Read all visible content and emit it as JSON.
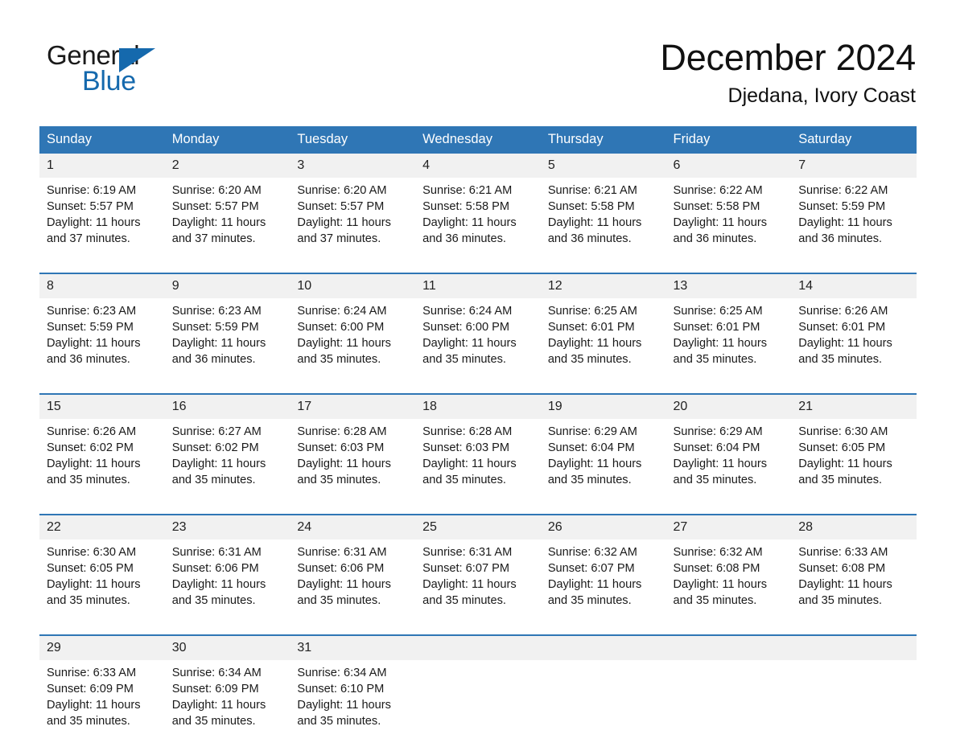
{
  "brand": {
    "name_part1": "General",
    "name_part2": "Blue",
    "accent_color": "#1569ad",
    "triangle_icon": "triangle-icon"
  },
  "header": {
    "title": "December 2024",
    "location": "Djedana, Ivory Coast"
  },
  "colors": {
    "header_bar": "#2f76b5",
    "daynum_strip": "#f1f1f1",
    "separator": "#2f76b5"
  },
  "weekdays": [
    "Sunday",
    "Monday",
    "Tuesday",
    "Wednesday",
    "Thursday",
    "Friday",
    "Saturday"
  ],
  "weeks": [
    {
      "days": [
        {
          "date": "1",
          "sunrise": "Sunrise: 6:19 AM",
          "sunset": "Sunset: 5:57 PM",
          "daylight": "Daylight: 11 hours and 37 minutes."
        },
        {
          "date": "2",
          "sunrise": "Sunrise: 6:20 AM",
          "sunset": "Sunset: 5:57 PM",
          "daylight": "Daylight: 11 hours and 37 minutes."
        },
        {
          "date": "3",
          "sunrise": "Sunrise: 6:20 AM",
          "sunset": "Sunset: 5:57 PM",
          "daylight": "Daylight: 11 hours and 37 minutes."
        },
        {
          "date": "4",
          "sunrise": "Sunrise: 6:21 AM",
          "sunset": "Sunset: 5:58 PM",
          "daylight": "Daylight: 11 hours and 36 minutes."
        },
        {
          "date": "5",
          "sunrise": "Sunrise: 6:21 AM",
          "sunset": "Sunset: 5:58 PM",
          "daylight": "Daylight: 11 hours and 36 minutes."
        },
        {
          "date": "6",
          "sunrise": "Sunrise: 6:22 AM",
          "sunset": "Sunset: 5:58 PM",
          "daylight": "Daylight: 11 hours and 36 minutes."
        },
        {
          "date": "7",
          "sunrise": "Sunrise: 6:22 AM",
          "sunset": "Sunset: 5:59 PM",
          "daylight": "Daylight: 11 hours and 36 minutes."
        }
      ]
    },
    {
      "days": [
        {
          "date": "8",
          "sunrise": "Sunrise: 6:23 AM",
          "sunset": "Sunset: 5:59 PM",
          "daylight": "Daylight: 11 hours and 36 minutes."
        },
        {
          "date": "9",
          "sunrise": "Sunrise: 6:23 AM",
          "sunset": "Sunset: 5:59 PM",
          "daylight": "Daylight: 11 hours and 36 minutes."
        },
        {
          "date": "10",
          "sunrise": "Sunrise: 6:24 AM",
          "sunset": "Sunset: 6:00 PM",
          "daylight": "Daylight: 11 hours and 35 minutes."
        },
        {
          "date": "11",
          "sunrise": "Sunrise: 6:24 AM",
          "sunset": "Sunset: 6:00 PM",
          "daylight": "Daylight: 11 hours and 35 minutes."
        },
        {
          "date": "12",
          "sunrise": "Sunrise: 6:25 AM",
          "sunset": "Sunset: 6:01 PM",
          "daylight": "Daylight: 11 hours and 35 minutes."
        },
        {
          "date": "13",
          "sunrise": "Sunrise: 6:25 AM",
          "sunset": "Sunset: 6:01 PM",
          "daylight": "Daylight: 11 hours and 35 minutes."
        },
        {
          "date": "14",
          "sunrise": "Sunrise: 6:26 AM",
          "sunset": "Sunset: 6:01 PM",
          "daylight": "Daylight: 11 hours and 35 minutes."
        }
      ]
    },
    {
      "days": [
        {
          "date": "15",
          "sunrise": "Sunrise: 6:26 AM",
          "sunset": "Sunset: 6:02 PM",
          "daylight": "Daylight: 11 hours and 35 minutes."
        },
        {
          "date": "16",
          "sunrise": "Sunrise: 6:27 AM",
          "sunset": "Sunset: 6:02 PM",
          "daylight": "Daylight: 11 hours and 35 minutes."
        },
        {
          "date": "17",
          "sunrise": "Sunrise: 6:28 AM",
          "sunset": "Sunset: 6:03 PM",
          "daylight": "Daylight: 11 hours and 35 minutes."
        },
        {
          "date": "18",
          "sunrise": "Sunrise: 6:28 AM",
          "sunset": "Sunset: 6:03 PM",
          "daylight": "Daylight: 11 hours and 35 minutes."
        },
        {
          "date": "19",
          "sunrise": "Sunrise: 6:29 AM",
          "sunset": "Sunset: 6:04 PM",
          "daylight": "Daylight: 11 hours and 35 minutes."
        },
        {
          "date": "20",
          "sunrise": "Sunrise: 6:29 AM",
          "sunset": "Sunset: 6:04 PM",
          "daylight": "Daylight: 11 hours and 35 minutes."
        },
        {
          "date": "21",
          "sunrise": "Sunrise: 6:30 AM",
          "sunset": "Sunset: 6:05 PM",
          "daylight": "Daylight: 11 hours and 35 minutes."
        }
      ]
    },
    {
      "days": [
        {
          "date": "22",
          "sunrise": "Sunrise: 6:30 AM",
          "sunset": "Sunset: 6:05 PM",
          "daylight": "Daylight: 11 hours and 35 minutes."
        },
        {
          "date": "23",
          "sunrise": "Sunrise: 6:31 AM",
          "sunset": "Sunset: 6:06 PM",
          "daylight": "Daylight: 11 hours and 35 minutes."
        },
        {
          "date": "24",
          "sunrise": "Sunrise: 6:31 AM",
          "sunset": "Sunset: 6:06 PM",
          "daylight": "Daylight: 11 hours and 35 minutes."
        },
        {
          "date": "25",
          "sunrise": "Sunrise: 6:31 AM",
          "sunset": "Sunset: 6:07 PM",
          "daylight": "Daylight: 11 hours and 35 minutes."
        },
        {
          "date": "26",
          "sunrise": "Sunrise: 6:32 AM",
          "sunset": "Sunset: 6:07 PM",
          "daylight": "Daylight: 11 hours and 35 minutes."
        },
        {
          "date": "27",
          "sunrise": "Sunrise: 6:32 AM",
          "sunset": "Sunset: 6:08 PM",
          "daylight": "Daylight: 11 hours and 35 minutes."
        },
        {
          "date": "28",
          "sunrise": "Sunrise: 6:33 AM",
          "sunset": "Sunset: 6:08 PM",
          "daylight": "Daylight: 11 hours and 35 minutes."
        }
      ]
    },
    {
      "days": [
        {
          "date": "29",
          "sunrise": "Sunrise: 6:33 AM",
          "sunset": "Sunset: 6:09 PM",
          "daylight": "Daylight: 11 hours and 35 minutes."
        },
        {
          "date": "30",
          "sunrise": "Sunrise: 6:34 AM",
          "sunset": "Sunset: 6:09 PM",
          "daylight": "Daylight: 11 hours and 35 minutes."
        },
        {
          "date": "31",
          "sunrise": "Sunrise: 6:34 AM",
          "sunset": "Sunset: 6:10 PM",
          "daylight": "Daylight: 11 hours and 35 minutes."
        },
        {
          "date": "",
          "sunrise": "",
          "sunset": "",
          "daylight": ""
        },
        {
          "date": "",
          "sunrise": "",
          "sunset": "",
          "daylight": ""
        },
        {
          "date": "",
          "sunrise": "",
          "sunset": "",
          "daylight": ""
        },
        {
          "date": "",
          "sunrise": "",
          "sunset": "",
          "daylight": ""
        }
      ]
    }
  ]
}
